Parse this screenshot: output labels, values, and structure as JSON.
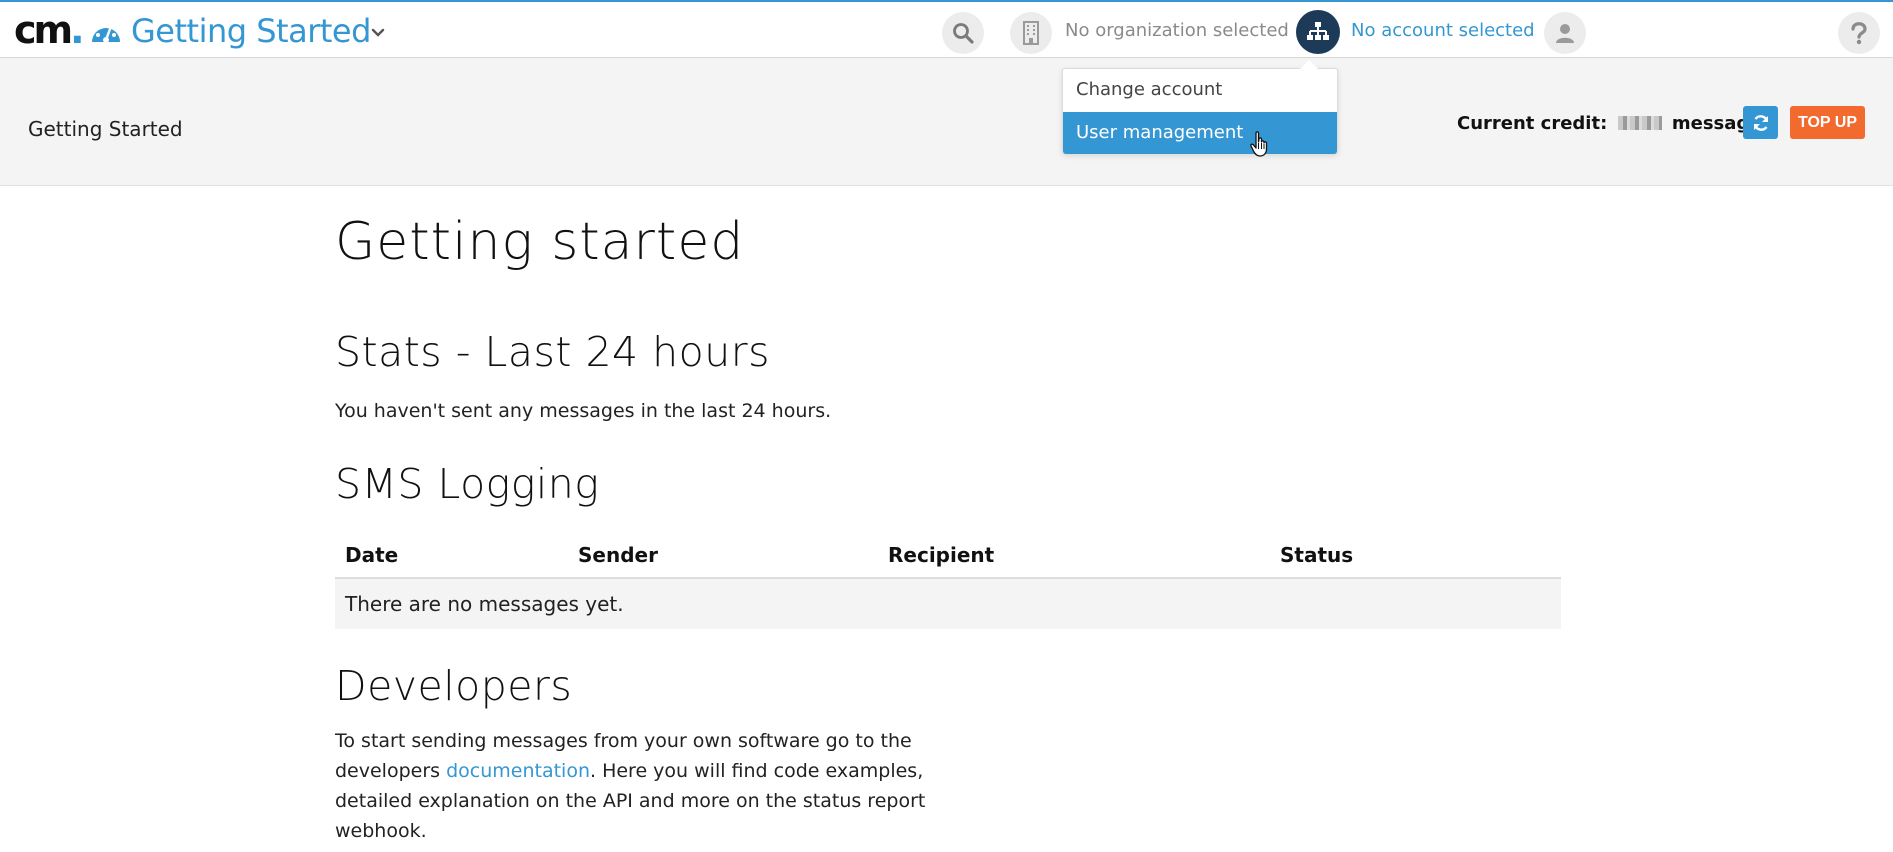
{
  "header": {
    "logo_text": "cm",
    "app_title": "Getting Started",
    "organization_label": "No organization selected",
    "account_label": "No account selected",
    "icons": [
      "gauge-icon",
      "chevron-down-icon",
      "search-icon",
      "building-icon",
      "sitemap-icon",
      "user-icon",
      "help-icon"
    ]
  },
  "subheader": {
    "title": "Getting Started",
    "credit_label": "Current credit:",
    "credit_unit": "messages",
    "topup_label": "TOP UP"
  },
  "dropdown": {
    "items": [
      {
        "label": "Change account"
      },
      {
        "label": "User management",
        "highlighted": true
      }
    ]
  },
  "main": {
    "page_title": "Getting started",
    "stats": {
      "heading": "Stats - Last 24 hours",
      "message": "You haven't sent any messages in the last 24 hours."
    },
    "sms_logging": {
      "heading": "SMS Logging",
      "columns": [
        "Date",
        "Sender",
        "Recipient",
        "Status"
      ],
      "empty_message": "There are no messages yet."
    },
    "developers": {
      "heading": "Developers",
      "text_before": "To start sending messages from your own software go to the developers ",
      "link_text": "documentation",
      "text_after": ". Here you will find code examples, detailed explanation on the API and more on the status report webhook."
    }
  },
  "colors": {
    "accent": "#3497d3",
    "account_icon_bg": "#1d3a58",
    "topup": "#f26a2e",
    "subheader_bg": "#f4f4f4"
  }
}
